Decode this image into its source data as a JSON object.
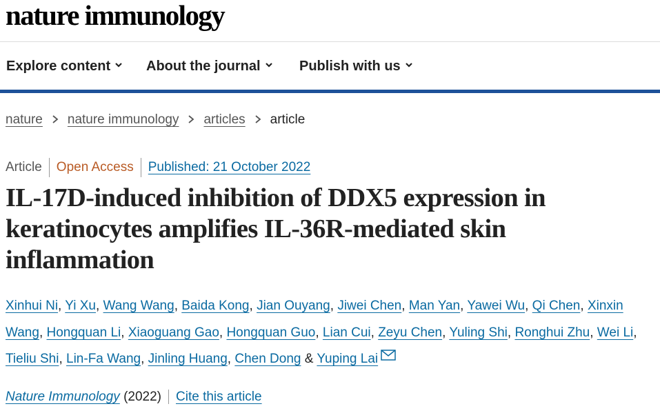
{
  "site": {
    "logo": "nature immunology"
  },
  "nav": {
    "items": [
      {
        "label": "Explore content"
      },
      {
        "label": "About the journal"
      },
      {
        "label": "Publish with us"
      }
    ]
  },
  "breadcrumb": {
    "items": [
      "nature",
      "nature immunology",
      "articles"
    ],
    "current": "article"
  },
  "meta": {
    "type": "Article",
    "access": "Open Access",
    "published": "Published: 21 October 2022"
  },
  "article": {
    "title": "IL-17D-induced inhibition of DDX5 expression in keratinocytes amplifies IL-36R-mediated skin inflammation"
  },
  "authors": {
    "list": [
      "Xinhui Ni",
      "Yi Xu",
      "Wang Wang",
      "Baida Kong",
      "Jian Ouyang",
      "Jiwei Chen",
      "Man Yan",
      "Yawei Wu",
      "Qi Chen",
      "Xinxin Wang",
      "Hongquan Li",
      "Xiaoguang Gao",
      "Hongquan Guo",
      "Lian Cui",
      "Zeyu Chen",
      "Yuling Shi",
      "Ronghui Zhu",
      "Wei Li",
      "Tieliu Shi",
      "Lin-Fa Wang",
      "Jinling Huang",
      "Chen Dong"
    ],
    "conjunction": "&",
    "last": "Yuping Lai",
    "separator": ","
  },
  "journal": {
    "name": "Nature Immunology",
    "year": "(2022)",
    "cite_label": "Cite this article"
  },
  "colors": {
    "nav_border": "#1d5199",
    "link": "#0a6aa1",
    "open_access": "#b95b25"
  }
}
